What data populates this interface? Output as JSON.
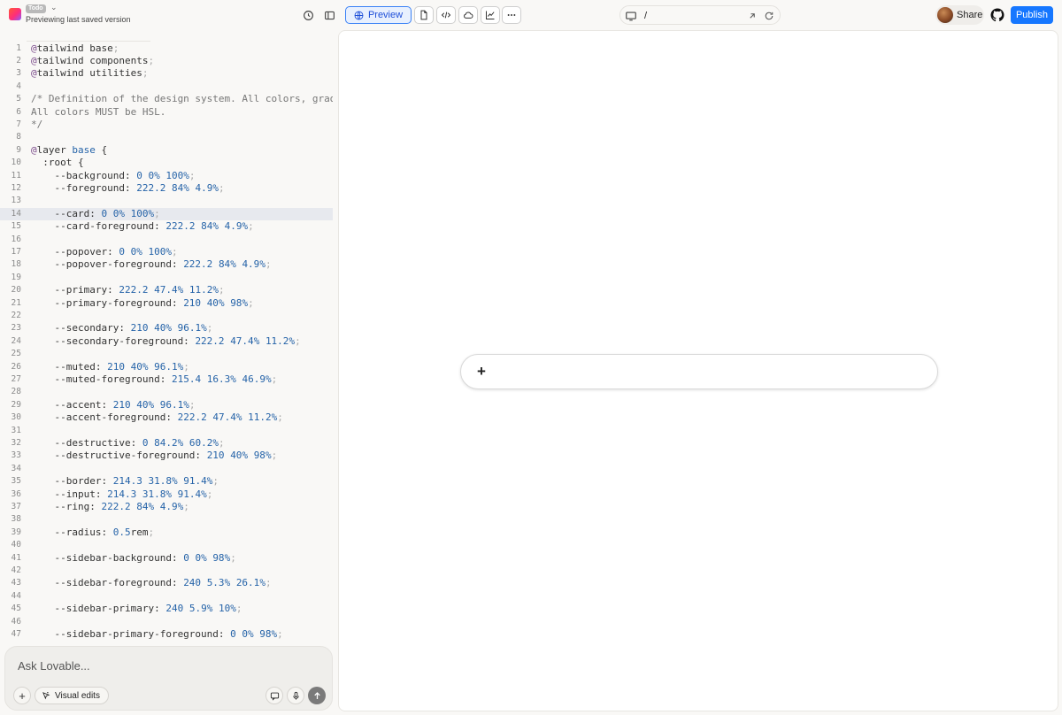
{
  "header": {
    "project_name": "Todo",
    "subtitle": "Previewing last saved version",
    "preview_label": "Preview",
    "url_path": "/",
    "share_label": "Share",
    "publish_label": "Publish"
  },
  "icons": {
    "history": "history-icon",
    "sidebar": "sidebar-toggle-icon",
    "globe": "globe-icon",
    "file": "file-icon",
    "code": "code-icon",
    "cloud": "cloud-icon",
    "chart": "chart-icon",
    "more": "more-icon",
    "device": "monitor-icon",
    "external": "external-link-icon",
    "reload": "refresh-icon",
    "github": "github-icon"
  },
  "editor": {
    "highlighted_line": 14,
    "lines": [
      "@tailwind base;",
      "@tailwind components;",
      "@tailwind utilities;",
      "",
      "/* Definition of the design system. All colors, gradien",
      "All colors MUST be HSL.",
      "*/",
      "",
      "@layer base {",
      "  :root {",
      "    --background: 0 0% 100%;",
      "    --foreground: 222.2 84% 4.9%;",
      "",
      "    --card: 0 0% 100%;",
      "    --card-foreground: 222.2 84% 4.9%;",
      "",
      "    --popover: 0 0% 100%;",
      "    --popover-foreground: 222.2 84% 4.9%;",
      "",
      "    --primary: 222.2 47.4% 11.2%;",
      "    --primary-foreground: 210 40% 98%;",
      "",
      "    --secondary: 210 40% 96.1%;",
      "    --secondary-foreground: 222.2 47.4% 11.2%;",
      "",
      "    --muted: 210 40% 96.1%;",
      "    --muted-foreground: 215.4 16.3% 46.9%;",
      "",
      "    --accent: 210 40% 96.1%;",
      "    --accent-foreground: 222.2 47.4% 11.2%;",
      "",
      "    --destructive: 0 84.2% 60.2%;",
      "    --destructive-foreground: 210 40% 98%;",
      "",
      "    --border: 214.3 31.8% 91.4%;",
      "    --input: 214.3 31.8% 91.4%;",
      "    --ring: 222.2 84% 4.9%;",
      "",
      "    --radius: 0.5rem;",
      "",
      "    --sidebar-background: 0 0% 98%;",
      "",
      "    --sidebar-foreground: 240 5.3% 26.1%;",
      "",
      "    --sidebar-primary: 240 5.9% 10%;",
      "",
      "    --sidebar-primary-foreground: 0 0% 98%;"
    ]
  },
  "chat": {
    "placeholder": "Ask Lovable...",
    "visual_edits_label": "Visual edits",
    "plus_label": "+"
  },
  "preview_panel": {
    "prompt_plus": "+"
  },
  "colors": {
    "accent_blue": "#1677ff",
    "preview_active": "#3b82f6",
    "editor_highlight": "#e7e9ee"
  }
}
